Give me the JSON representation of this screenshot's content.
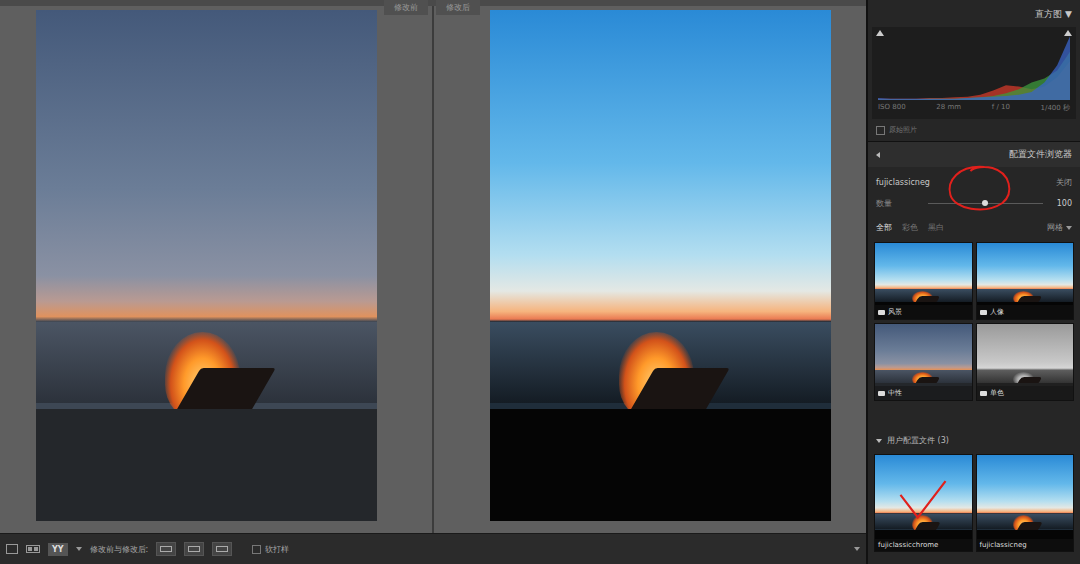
{
  "panes": [
    {
      "label": "修改前",
      "kind": "before"
    },
    {
      "label": "修改后",
      "kind": "after"
    }
  ],
  "toolbar": {
    "view_button": "YY",
    "compare_label": "修改前与修改后:",
    "soft_proof": {
      "label": "软打样",
      "checked": false
    }
  },
  "histogram": {
    "title": "直方图",
    "toggle": "▼",
    "chart": {
      "series": [
        {
          "name": "red",
          "color": "#d23a2a",
          "values": [
            2,
            2,
            2,
            2,
            3,
            3,
            4,
            5,
            8,
            14,
            22,
            20,
            16,
            20,
            34,
            58
          ]
        },
        {
          "name": "green",
          "color": "#3c9a3c",
          "values": [
            1,
            1,
            1,
            1,
            2,
            2,
            2,
            3,
            4,
            6,
            10,
            16,
            26,
            32,
            44,
            72
          ]
        },
        {
          "name": "blue",
          "color": "#3a64c8",
          "values": [
            3,
            2,
            2,
            2,
            2,
            2,
            2,
            3,
            4,
            5,
            6,
            8,
            12,
            26,
            52,
            95
          ]
        }
      ]
    },
    "info": [
      "ISO 800",
      "28 mm",
      "f / 10",
      "1/400 秒"
    ],
    "original_photo": {
      "label": "原始照片",
      "checked": false
    }
  },
  "profile_browser": {
    "title": "配置文件浏览器",
    "profile": "fujiclassicneg",
    "close": "关闭",
    "amount": {
      "label": "数量",
      "level": 0.5,
      "reading": "100",
      "circled": true
    },
    "filters": [
      {
        "label": "全部",
        "selected": true
      },
      {
        "label": "彩色",
        "selected": false
      },
      {
        "label": "黑白",
        "selected": false
      }
    ],
    "view": "网格",
    "profiles": [
      {
        "label": "风景",
        "kind": "after"
      },
      {
        "label": "人像",
        "kind": "after"
      },
      {
        "label": "中性",
        "kind": "before"
      },
      {
        "label": "单色",
        "kind": "mono"
      }
    ],
    "user_group": {
      "title": "用户配置文件 (3)",
      "expanded": true,
      "profiles": [
        {
          "label": "fujiclassicchrome",
          "kind": "after",
          "marked": true
        },
        {
          "label": "fujiclassicneg",
          "kind": "after",
          "marked": false
        }
      ]
    }
  }
}
